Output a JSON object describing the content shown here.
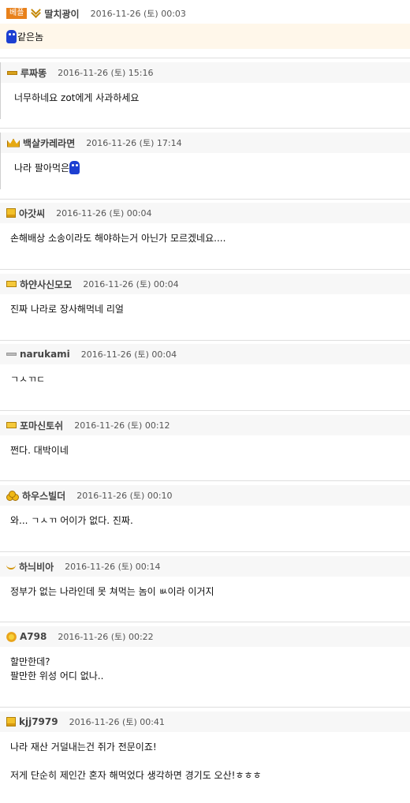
{
  "comments": [
    {
      "best_label": "베플",
      "level_icon": "chevron-rank-icon",
      "nickname": "딸치광이",
      "date": "2016-11-26 (토) 00:03",
      "emoticon": "blue-figure-emoticon",
      "text": "같은놈"
    },
    {
      "level_icon": "bar-rank-icon",
      "nickname": "루짜똥",
      "date": "2016-11-26 (토) 15:16",
      "text": "너무하네요 zot에게 사과하세요"
    },
    {
      "level_icon": "crown-rank-icon",
      "nickname": "백살카레라면",
      "date": "2016-11-26 (토) 17:14",
      "text": "나라 팔아먹은",
      "emoticon": "blue-face-emoticon"
    },
    {
      "level_icon": "box-rank-icon",
      "nickname": "아갓씨",
      "date": "2016-11-26 (토) 00:04",
      "text": "손해배상 소송이라도 해야하는거 아닌가 모르겠네요...."
    },
    {
      "level_icon": "boxline-rank-icon",
      "nickname": "하얀사신모모",
      "date": "2016-11-26 (토) 00:04",
      "text": "진짜 나라로 장사해먹네 리얼"
    },
    {
      "level_icon": "gray-bar-rank-icon",
      "nickname": "narukami",
      "date": "2016-11-26 (토) 00:04",
      "text": "ㄱㅅㄲㄷ"
    },
    {
      "level_icon": "boxline-rank-icon",
      "nickname": "포마신토쉬",
      "date": "2016-11-26 (토) 00:12",
      "text": "쩐다. 대박이네"
    },
    {
      "level_icon": "coins-rank-icon",
      "nickname": "하우스빌더",
      "date": "2016-11-26 (토) 00:10",
      "text": "와... ㄱㅅㄲ 어이가 없다. 진짜."
    },
    {
      "level_icon": "smile-rank-icon",
      "nickname": "하늬비아",
      "date": "2016-11-26 (토) 00:14",
      "text": "정부가 없는 나라인데 못 쳐먹는 놈이 ㅄ이라 이거지"
    },
    {
      "level_icon": "flower-rank-icon",
      "nickname": "A798",
      "date": "2016-11-26 (토) 00:22",
      "text": "할만한데?\n팔만한 위성 어디 없나.."
    },
    {
      "level_icon": "box-rank-icon",
      "nickname": "kjj7979",
      "date": "2016-11-26 (토) 00:41",
      "text": "나라 재산 거덜내는건 쥐가 전문이죠!\n\n저게 단순히 제인간 혼자 해먹었다 생각하면 경기도 오산!ㅎㅎㅎ"
    }
  ],
  "colors": {
    "best_badge": "#e8811c",
    "best_background": "#fff7ea",
    "emoticon_blue": "#1d3fd1"
  }
}
